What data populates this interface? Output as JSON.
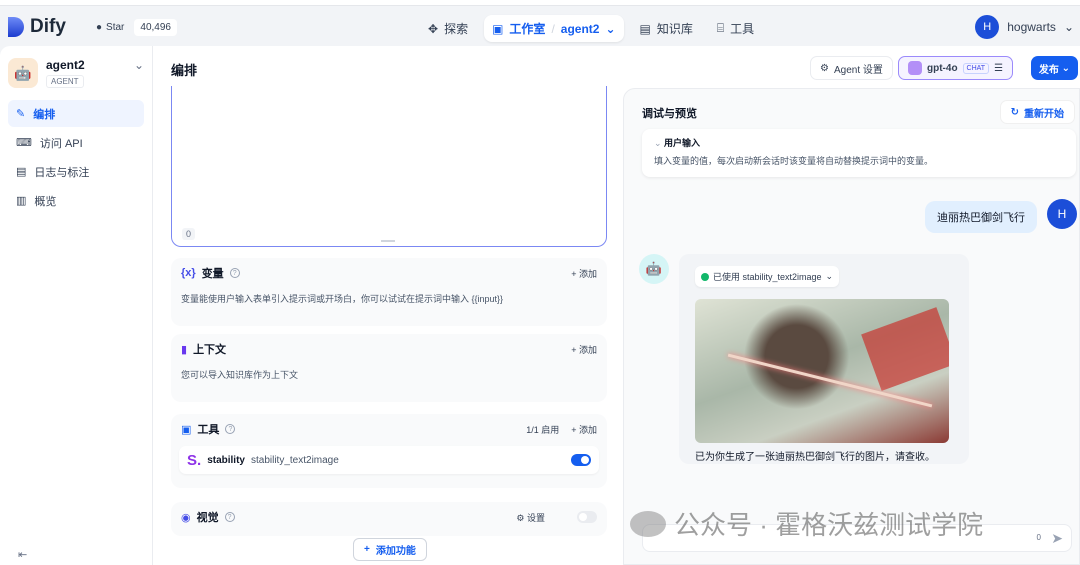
{
  "header": {
    "logo": "Dify",
    "star_label": "Star",
    "star_count": "40,496",
    "nav": [
      {
        "label": "探索"
      },
      {
        "label": "工作室"
      },
      {
        "label": "知识库"
      },
      {
        "label": "工具"
      }
    ],
    "current_app": "agent2",
    "user_initial": "H",
    "user_name": "hogwarts"
  },
  "sidebar": {
    "app_name": "agent2",
    "app_type": "AGENT",
    "items": [
      {
        "label": "编排"
      },
      {
        "label": "访问 API"
      },
      {
        "label": "日志与标注"
      },
      {
        "label": "概览"
      }
    ]
  },
  "main": {
    "title": "编排",
    "agent_settings": "Agent 设置",
    "model": "gpt-4o",
    "model_mode": "CHAT",
    "publish": "发布",
    "prompt_count": "0",
    "variables": {
      "title": "变量",
      "add": "添加",
      "desc": "变量能使用户输入表单引入提示词或开场白，你可以试试在提示词中输入 {{input}}"
    },
    "context": {
      "title": "上下文",
      "add": "添加",
      "desc": "您可以导入知识库作为上下文"
    },
    "tools": {
      "title": "工具",
      "enabled": "1/1 启用",
      "add": "添加",
      "items": [
        {
          "provider": "stability",
          "name": "stability_text2image",
          "enabled": true
        }
      ]
    },
    "vision": {
      "title": "视觉",
      "settings": "设置",
      "enabled": false
    },
    "add_feature": "添加功能"
  },
  "debug": {
    "title": "调试与预览",
    "restart": "重新开始",
    "user_input_title": "用户输入",
    "user_input_desc": "填入变量的值，每次启动新会话时该变量将自动替换提示词中的变量。",
    "user_message": "迪丽热巴御剑飞行",
    "tool_used": "已使用 stability_text2image",
    "bot_reply": "已为你生成了一张迪丽热巴御剑飞行的图片，请查收。",
    "input_count": "0"
  },
  "watermark": "公众号 · 霍格沃兹测试学院"
}
